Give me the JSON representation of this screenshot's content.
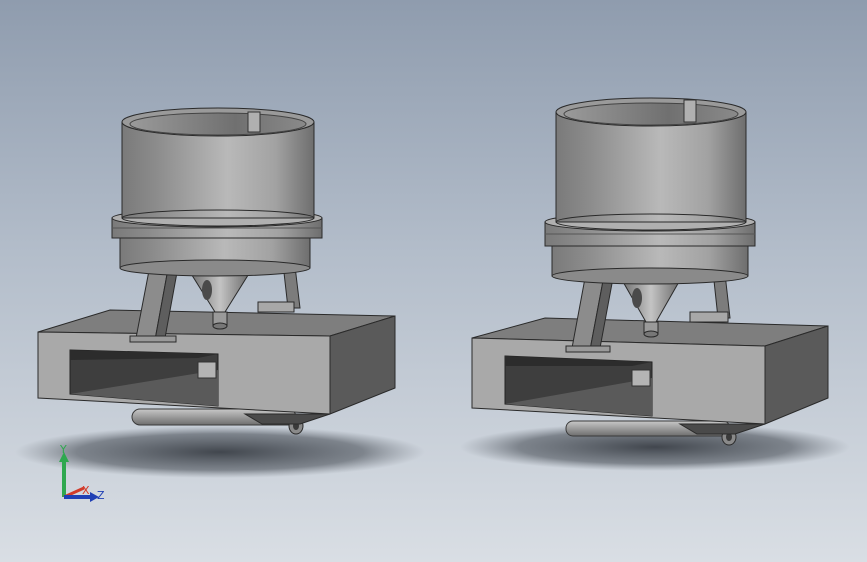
{
  "viewport": {
    "background_top": "#8f9cae",
    "background_bottom": "#d9dee4"
  },
  "models": [
    {
      "name": "left-feeder-assembly"
    },
    {
      "name": "right-feeder-assembly"
    }
  ],
  "triad": {
    "y_label": "Y",
    "x_label": "X",
    "z_label": "Z",
    "colors": {
      "y": "#2fa84f",
      "x": "#d23a2a",
      "z": "#1f3fb5"
    }
  }
}
